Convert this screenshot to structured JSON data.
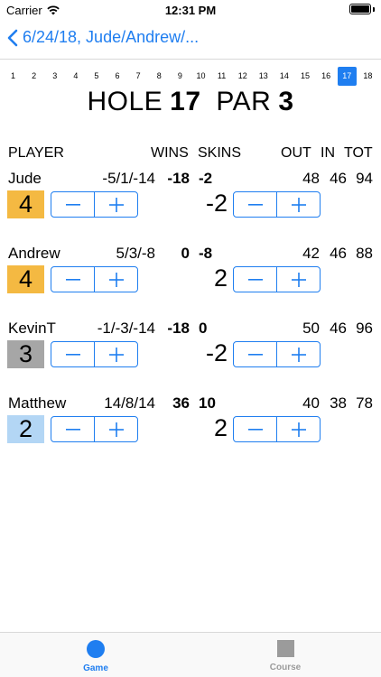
{
  "status": {
    "carrier": "Carrier",
    "time": "12:31 PM"
  },
  "nav": {
    "back_title": "6/24/18, Jude/Andrew/..."
  },
  "holes": [
    "1",
    "2",
    "3",
    "4",
    "5",
    "6",
    "7",
    "8",
    "9",
    "10",
    "11",
    "12",
    "13",
    "14",
    "15",
    "16",
    "17",
    "18"
  ],
  "selected_hole": "17",
  "header": {
    "hole_label": "HOLE",
    "hole_number": "17",
    "par_label": "PAR",
    "par_number": "3"
  },
  "columns": {
    "player": "PLAYER",
    "wins": "WINS",
    "skins": "SKINS",
    "out": "OUT",
    "in": "IN",
    "tot": "TOT"
  },
  "players": [
    {
      "name": "Jude",
      "wins_detail": "-5/1/-14",
      "wins_total": "-18",
      "skins": "-2",
      "out": "48",
      "in": "46",
      "tot": "94",
      "score": "4",
      "score_color": "#f4b942",
      "skin_value": "-2"
    },
    {
      "name": "Andrew",
      "wins_detail": "5/3/-8",
      "wins_total": "0",
      "skins": "-8",
      "out": "42",
      "in": "46",
      "tot": "88",
      "score": "4",
      "score_color": "#f4b942",
      "skin_value": "2"
    },
    {
      "name": "KevinT",
      "wins_detail": "-1/-3/-14",
      "wins_total": "-18",
      "skins": "0",
      "out": "50",
      "in": "46",
      "tot": "96",
      "score": "3",
      "score_color": "#a6a6a6",
      "skin_value": "-2"
    },
    {
      "name": "Matthew",
      "wins_detail": "14/8/14",
      "wins_total": "36",
      "skins": "10",
      "out": "40",
      "in": "38",
      "tot": "78",
      "score": "2",
      "score_color": "#b3d6f5",
      "skin_value": "2"
    }
  ],
  "tabs": {
    "game": "Game",
    "course": "Course"
  },
  "colors": {
    "accent": "#1f7ef0",
    "inactive": "#9b9b9b"
  }
}
